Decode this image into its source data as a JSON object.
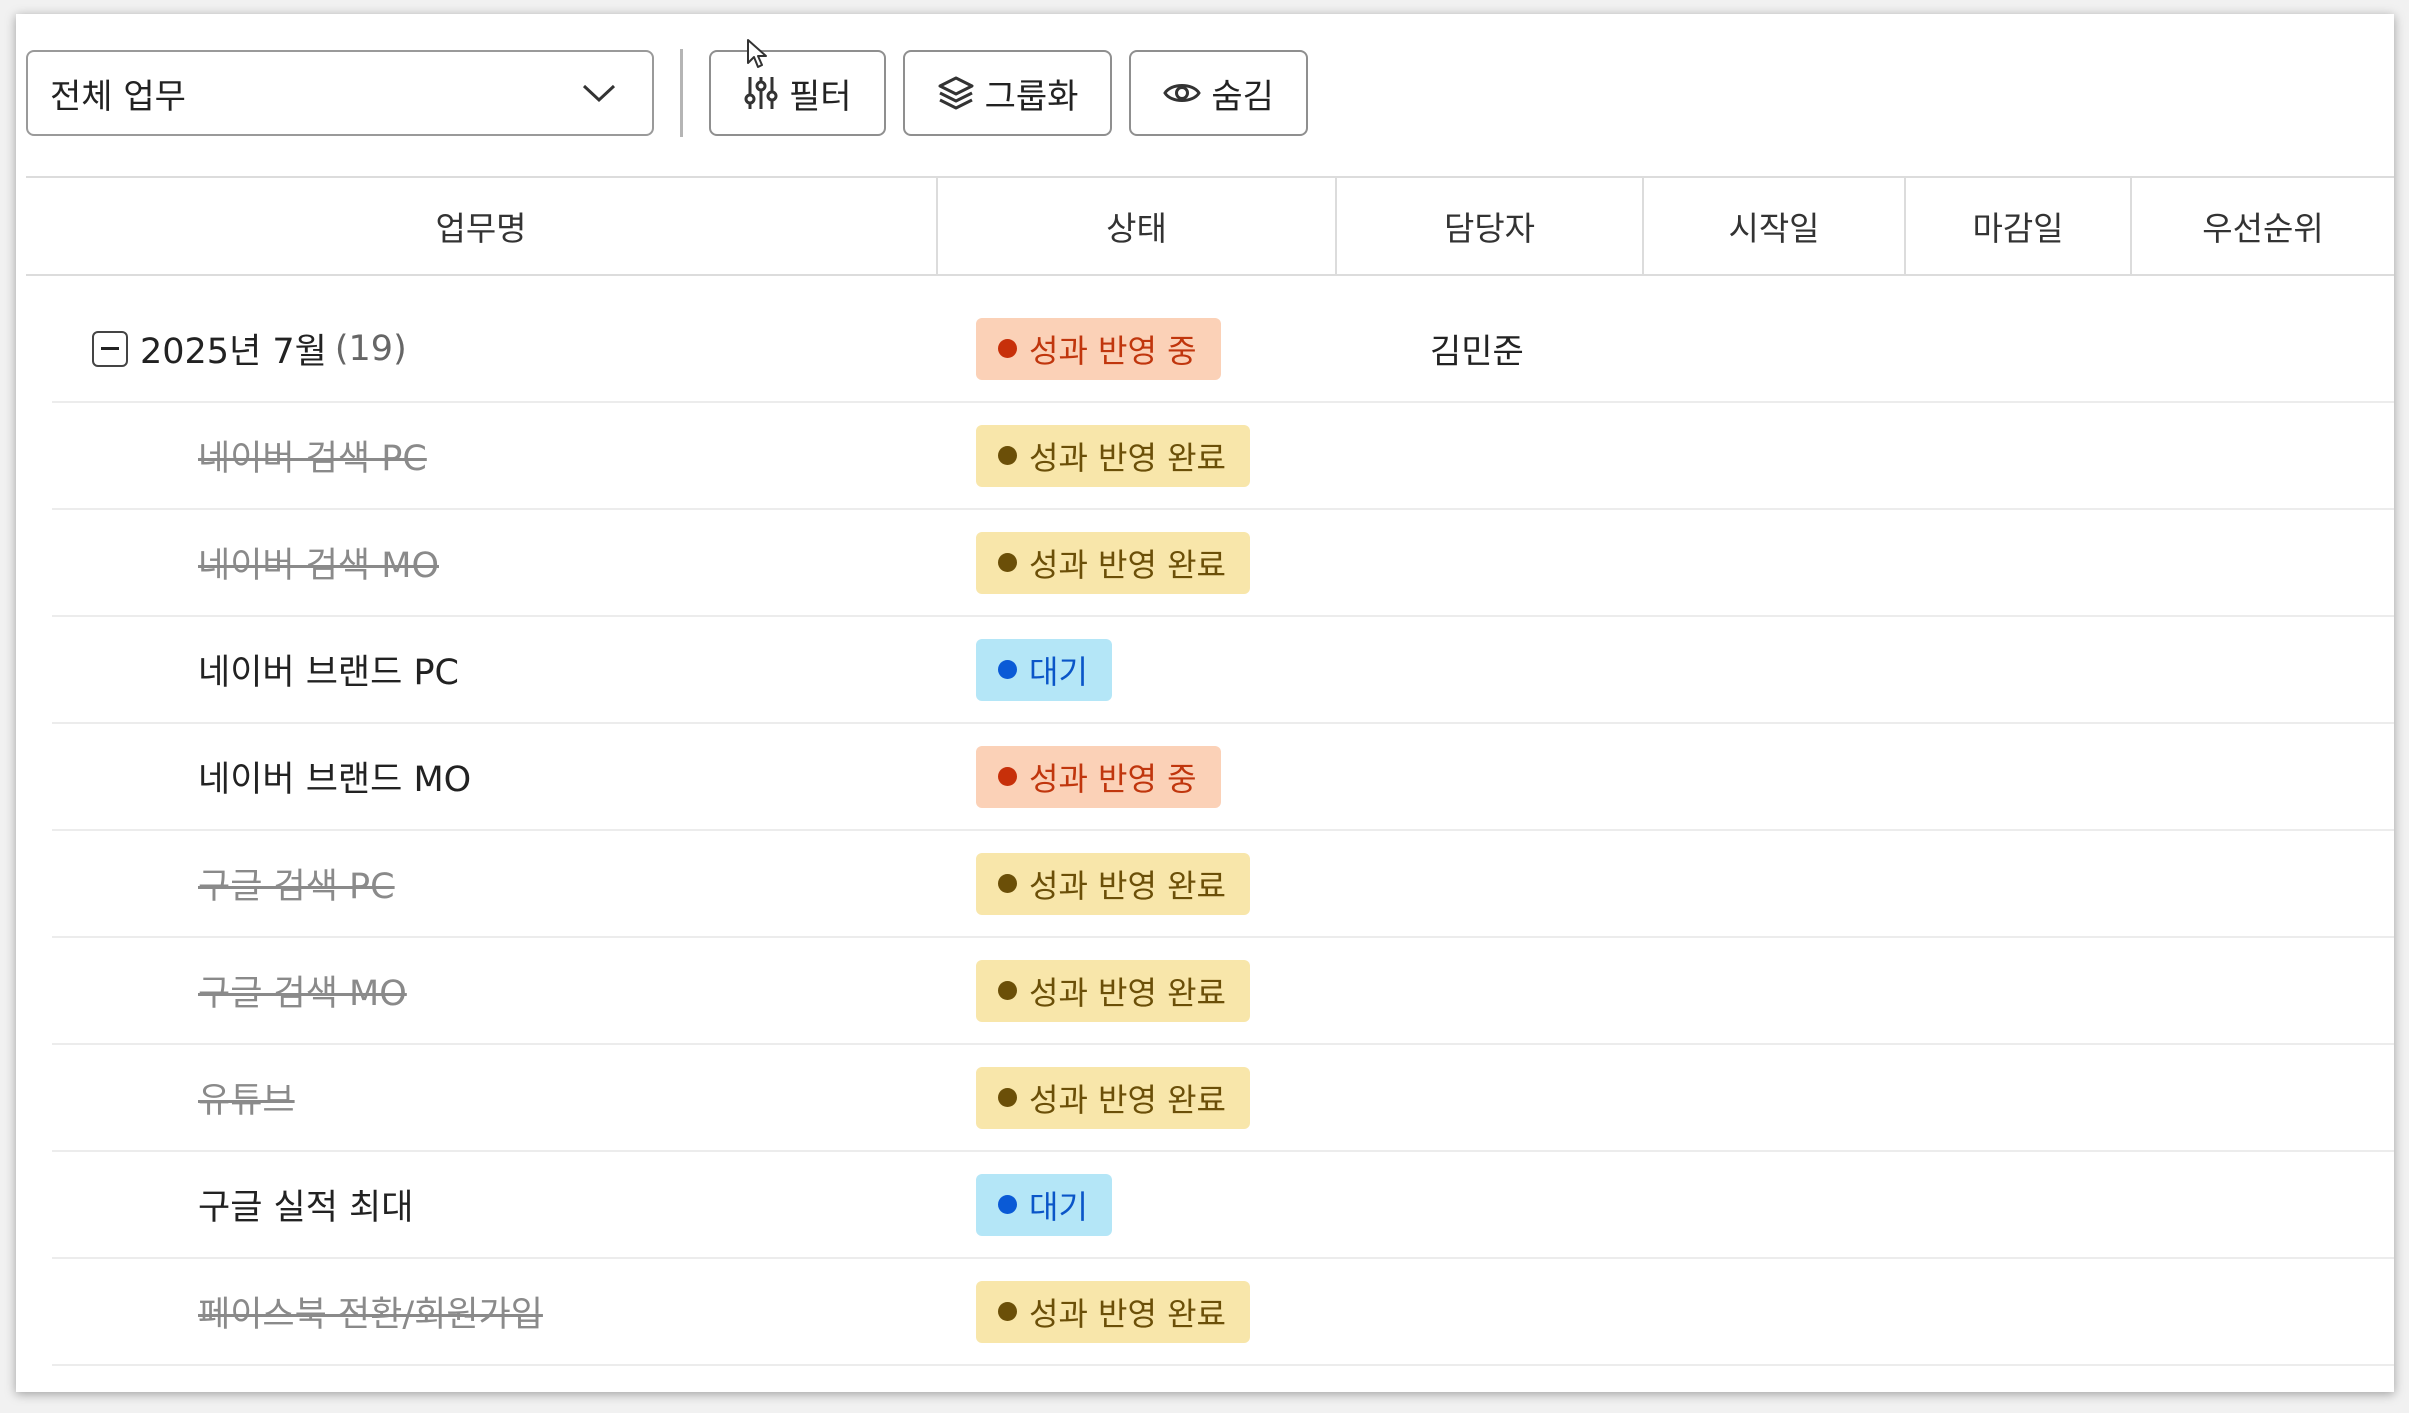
{
  "toolbar": {
    "select_value": "전체 업무",
    "filter_label": "필터",
    "group_label": "그룹화",
    "hide_label": "숨김"
  },
  "table": {
    "columns": [
      "업무명",
      "상태",
      "담당자",
      "시작일",
      "마감일",
      "우선순위"
    ],
    "group": {
      "title": "2025년 7월",
      "count": "(19)",
      "status": "성과 반영 중",
      "owner": "김민준"
    },
    "rows": [
      {
        "name": "네이버 검색 PC",
        "status": "성과 반영 완료"
      },
      {
        "name": "네이버 검색 MO",
        "status": "성과 반영 완료"
      },
      {
        "name": "네이버 브랜드 PC",
        "status": "대기"
      },
      {
        "name": "네이버 브랜드 MO",
        "status": "성과 반영 중"
      },
      {
        "name": "구글 검색 PC",
        "status": "성과 반영 완료"
      },
      {
        "name": "구글 검색 MO",
        "status": "성과 반영 완료"
      },
      {
        "name": "유튜브",
        "status": "성과 반영 완료"
      },
      {
        "name": "구글 실적 최대",
        "status": "대기"
      },
      {
        "name": "페이스북 전환/회원가입",
        "status": "성과 반영 완료"
      }
    ]
  },
  "colors": {
    "status_in_progress_bg": "#fbd1b7",
    "status_in_progress_fg": "#c0360d",
    "status_done_bg": "#f8e6aa",
    "status_done_fg": "#6b4f08",
    "status_waiting_bg": "#b4e6f7",
    "status_waiting_fg": "#0a55c8"
  },
  "icons": {
    "select": "chevron-down-icon",
    "filter": "sliders-icon",
    "group": "layers-icon",
    "hide": "eye-icon",
    "group_toggle": "collapse-minus-icon"
  }
}
